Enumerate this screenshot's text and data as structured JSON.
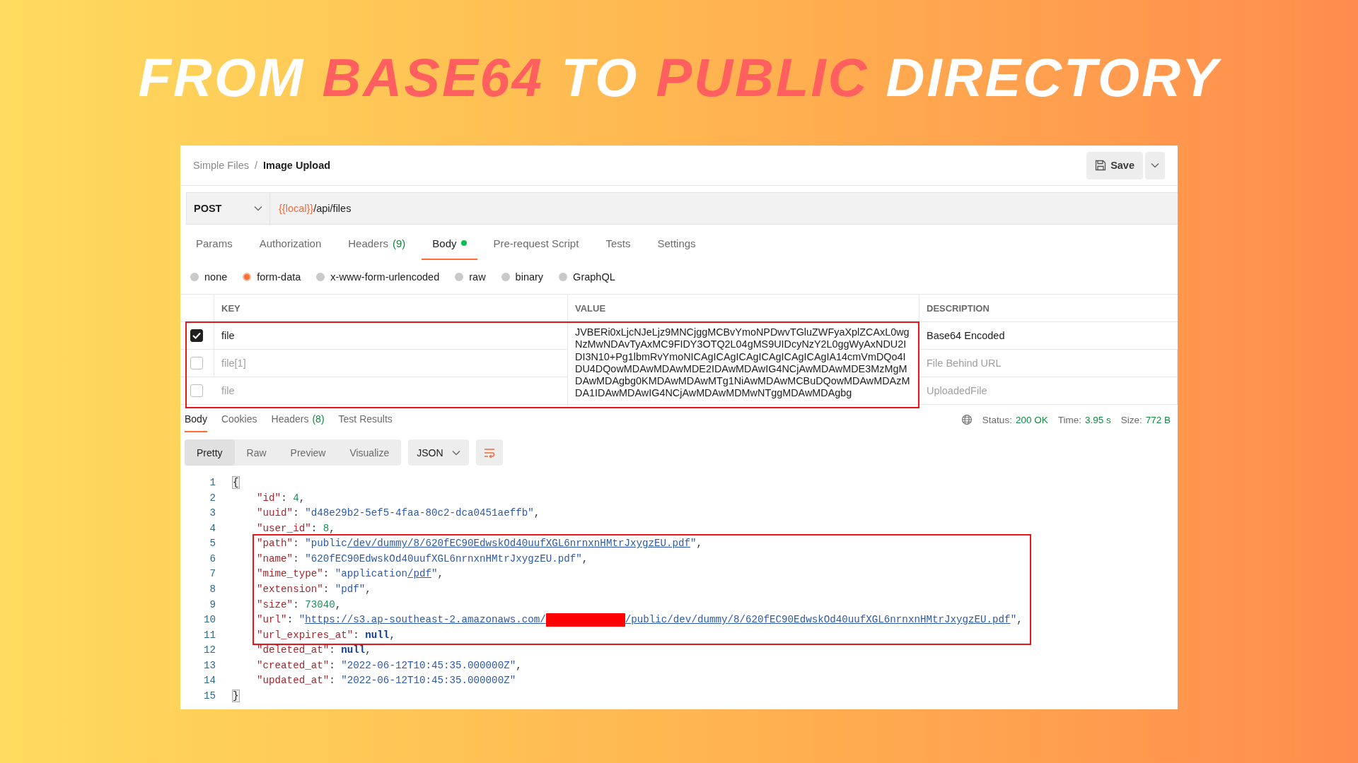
{
  "headline": [
    {
      "text": "FROM ",
      "highlight": false
    },
    {
      "text": "BASE64",
      "highlight": true
    },
    {
      "text": " TO ",
      "highlight": false
    },
    {
      "text": "PUBLIC",
      "highlight": true
    },
    {
      "text": " DIRECTORY",
      "highlight": false
    }
  ],
  "breadcrumb": {
    "parent": "Simple Files",
    "separator": "/",
    "current": "Image Upload"
  },
  "save_button": {
    "label": "Save"
  },
  "request": {
    "method": "POST",
    "url_variable": "{{local}}",
    "url_path": "/api/files"
  },
  "request_tabs": [
    {
      "label": "Params",
      "selected": false
    },
    {
      "label": "Authorization",
      "selected": false
    },
    {
      "label": "Headers",
      "count": "(9)",
      "selected": false
    },
    {
      "label": "Body",
      "indicator": true,
      "selected": true
    },
    {
      "label": "Pre-request Script",
      "selected": false
    },
    {
      "label": "Tests",
      "selected": false
    },
    {
      "label": "Settings",
      "selected": false
    }
  ],
  "body_types": [
    {
      "label": "none",
      "selected": false
    },
    {
      "label": "form-data",
      "selected": true
    },
    {
      "label": "x-www-form-urlencoded",
      "selected": false
    },
    {
      "label": "raw",
      "selected": false
    },
    {
      "label": "binary",
      "selected": false
    },
    {
      "label": "GraphQL",
      "selected": false
    }
  ],
  "params_table": {
    "columns": [
      "KEY",
      "VALUE",
      "DESCRIPTION"
    ],
    "rows": [
      {
        "checked": true,
        "key": "file",
        "value": "JVBERi0xLjcNJeLjz9MNCjggMCBvYmoNPDwvTGluZWFyaXplZCAxL0wgNzMwNDAvTyAxMC9FIDY3OTQ2L04gMS9UIDcyNzY2L0ggWyAxNDU2IDI3N10+Pg1lbmRvYmoNICAgICAgICAgICAgICAgICAgIA14cmVmDQo4IDU4DQowMDAwMDAwMDE2IDAwMDAwIG4NCjAwMDAwMDE3MzMgMDAwMDAgbg0KMDAwMDAwMTg1NiAwMDAwMCBuDQowMDAwMDAzMDA1IDAwMDAwIG4NCjAwMDAwMDMwNTggMDAwMDAgbg",
        "description": "Base64 Encoded",
        "highlighted": true
      },
      {
        "checked": false,
        "key": "file[1]",
        "description": "File Behind URL",
        "highlighted": true
      },
      {
        "checked": false,
        "key": "file",
        "description": "UploadedFile",
        "highlighted": true
      }
    ]
  },
  "response_tabs": [
    {
      "label": "Body",
      "selected": true
    },
    {
      "label": "Cookies",
      "selected": false
    },
    {
      "label": "Headers",
      "count": "(8)",
      "selected": false
    },
    {
      "label": "Test Results",
      "selected": false
    }
  ],
  "status": [
    {
      "label": "Status:",
      "value": "200 OK"
    },
    {
      "label": "Time:",
      "value": "3.95 s"
    },
    {
      "label": "Size:",
      "value": "772 B"
    }
  ],
  "view_modes": [
    {
      "label": "Pretty",
      "selected": true
    },
    {
      "label": "Raw",
      "selected": false
    },
    {
      "label": "Preview",
      "selected": false
    },
    {
      "label": "Visualize",
      "selected": false
    }
  ],
  "format": "JSON",
  "code_lines": [
    {
      "number": "1",
      "highlighted": false,
      "tokens": [
        {
          "kind": "bracket",
          "text": "{"
        }
      ]
    },
    {
      "number": "2",
      "highlighted": false,
      "tokens": [
        {
          "kind": "key",
          "text": "    \"id\""
        },
        {
          "kind": "punct",
          "text": ": "
        },
        {
          "kind": "number",
          "text": "4"
        },
        {
          "kind": "punct",
          "text": ","
        }
      ]
    },
    {
      "number": "3",
      "highlighted": false,
      "tokens": [
        {
          "kind": "key",
          "text": "    \"uuid\""
        },
        {
          "kind": "punct",
          "text": ": "
        },
        {
          "kind": "string",
          "text": "\"d48e29b2-5ef5-4faa-80c2-dca0451aeffb\""
        },
        {
          "kind": "punct",
          "text": ","
        }
      ]
    },
    {
      "number": "4",
      "highlighted": false,
      "tokens": [
        {
          "kind": "key",
          "text": "    \"user_id\""
        },
        {
          "kind": "punct",
          "text": ": "
        },
        {
          "kind": "number",
          "text": "8"
        },
        {
          "kind": "punct",
          "text": ","
        }
      ]
    },
    {
      "number": "5",
      "highlighted": true,
      "tokens": [
        {
          "kind": "key",
          "text": "    \"path\""
        },
        {
          "kind": "punct",
          "text": ": "
        },
        {
          "kind": "string",
          "text": "\"public"
        },
        {
          "kind": "link",
          "text": "/dev/dummy/8/620fEC90EdwskOd40uufXGL6nrnxnHMtrJxygzEU.pdf"
        },
        {
          "kind": "string",
          "text": "\""
        },
        {
          "kind": "punct",
          "text": ","
        }
      ]
    },
    {
      "number": "6",
      "highlighted": true,
      "tokens": [
        {
          "kind": "key",
          "text": "    \"name\""
        },
        {
          "kind": "punct",
          "text": ": "
        },
        {
          "kind": "string",
          "text": "\"620fEC90EdwskOd40uufXGL6nrnxnHMtrJxygzEU.pdf\""
        },
        {
          "kind": "punct",
          "text": ","
        }
      ]
    },
    {
      "number": "7",
      "highlighted": true,
      "tokens": [
        {
          "kind": "key",
          "text": "    \"mime_type\""
        },
        {
          "kind": "punct",
          "text": ": "
        },
        {
          "kind": "string",
          "text": "\"application"
        },
        {
          "kind": "link",
          "text": "/pdf"
        },
        {
          "kind": "string",
          "text": "\""
        },
        {
          "kind": "punct",
          "text": ","
        }
      ]
    },
    {
      "number": "8",
      "highlighted": true,
      "tokens": [
        {
          "kind": "key",
          "text": "    \"extension\""
        },
        {
          "kind": "punct",
          "text": ": "
        },
        {
          "kind": "string",
          "text": "\"pdf\""
        },
        {
          "kind": "punct",
          "text": ","
        }
      ]
    },
    {
      "number": "9",
      "highlighted": true,
      "tokens": [
        {
          "kind": "key",
          "text": "    \"size\""
        },
        {
          "kind": "punct",
          "text": ": "
        },
        {
          "kind": "number",
          "text": "73040"
        },
        {
          "kind": "punct",
          "text": ","
        }
      ]
    },
    {
      "number": "10",
      "highlighted": true,
      "tokens": [
        {
          "kind": "key",
          "text": "    \"url\""
        },
        {
          "kind": "punct",
          "text": ": "
        },
        {
          "kind": "string",
          "text": "\""
        },
        {
          "kind": "link",
          "text": "https://s3.ap-southeast-2.amazonaws.com/"
        },
        {
          "kind": "redacted"
        },
        {
          "kind": "link",
          "text": "/public/dev/dummy/8/620fEC90EdwskOd40uufXGL6nrnxnHMtrJxygzEU.pdf"
        },
        {
          "kind": "string",
          "text": "\""
        },
        {
          "kind": "punct",
          "text": ","
        }
      ]
    },
    {
      "number": "11",
      "highlighted": true,
      "tokens": [
        {
          "kind": "key",
          "text": "    \"url_expires_at\""
        },
        {
          "kind": "punct",
          "text": ": "
        },
        {
          "kind": "null",
          "text": "null"
        },
        {
          "kind": "punct",
          "text": ","
        }
      ]
    },
    {
      "number": "12",
      "highlighted": false,
      "tokens": [
        {
          "kind": "key",
          "text": "    \"deleted_at\""
        },
        {
          "kind": "punct",
          "text": ": "
        },
        {
          "kind": "null",
          "text": "null"
        },
        {
          "kind": "punct",
          "text": ","
        }
      ]
    },
    {
      "number": "13",
      "highlighted": false,
      "tokens": [
        {
          "kind": "key",
          "text": "    \"created_at\""
        },
        {
          "kind": "punct",
          "text": ": "
        },
        {
          "kind": "string",
          "text": "\"2022-06-12T10:45:35.000000Z\""
        },
        {
          "kind": "punct",
          "text": ","
        }
      ]
    },
    {
      "number": "14",
      "highlighted": false,
      "tokens": [
        {
          "kind": "key",
          "text": "    \"updated_at\""
        },
        {
          "kind": "punct",
          "text": ": "
        },
        {
          "kind": "string",
          "text": "\"2022-06-12T10:45:35.000000Z\""
        }
      ]
    },
    {
      "number": "15",
      "highlighted": false,
      "tokens": [
        {
          "kind": "bracket",
          "text": "}"
        }
      ]
    }
  ]
}
